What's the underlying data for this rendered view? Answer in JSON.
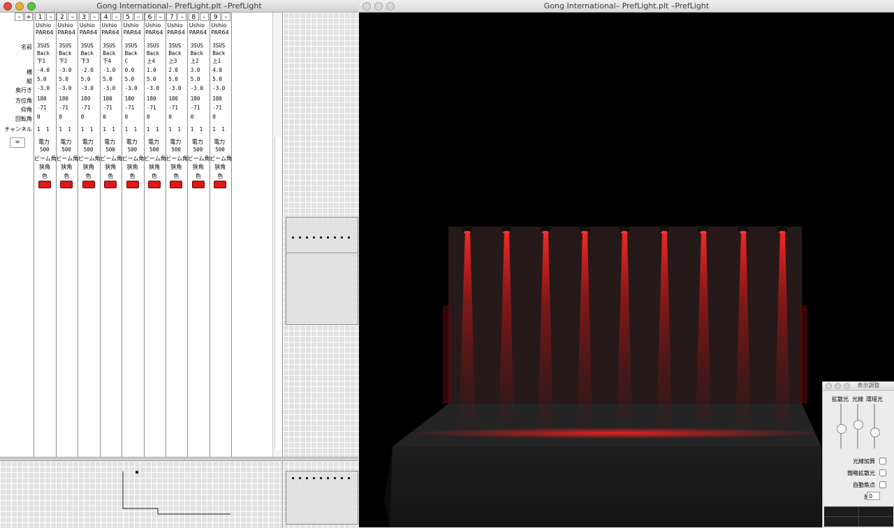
{
  "window_left": {
    "title": "Gong International– PrefLight.plt –PrefLight"
  },
  "window_right": {
    "title": "Gong International– PrefLight.plt –PrefLight"
  },
  "header": {
    "minus_label": "–",
    "plus_label": "+",
    "equals_label": "="
  },
  "row_labels": {
    "name": "名前",
    "x": "横",
    "y": "縦",
    "z": "奥行き",
    "azimuth": "方位角",
    "elevation": "仰角",
    "rotation": "回転角",
    "channel": "チャンネル"
  },
  "fixture_labels": {
    "power": "電力",
    "beam": "ビーム角",
    "color": "色"
  },
  "fixtures": [
    {
      "num": "1",
      "make": "Ushio",
      "model": "PAR64",
      "name1": "3SUS",
      "name2": "Back",
      "name3": "下1",
      "x": "-4.0",
      "y": "5.0",
      "z": "-3.0",
      "azimuth": "180",
      "elevation": "-71",
      "rotation": "0",
      "ch1": "1",
      "ch2": "1",
      "power": "500",
      "beam": "狭角"
    },
    {
      "num": "2",
      "make": "Ushio",
      "model": "PAR64",
      "name1": "3SUS",
      "name2": "Back",
      "name3": "下2",
      "x": "-3.0",
      "y": "5.0",
      "z": "-3.0",
      "azimuth": "180",
      "elevation": "-71",
      "rotation": "0",
      "ch1": "1",
      "ch2": "1",
      "power": "500",
      "beam": "狭角"
    },
    {
      "num": "3",
      "make": "Ushio",
      "model": "PAR64",
      "name1": "3SUS",
      "name2": "Back",
      "name3": "下3",
      "x": "-2.0",
      "y": "5.0",
      "z": "-3.0",
      "azimuth": "180",
      "elevation": "-71",
      "rotation": "0",
      "ch1": "1",
      "ch2": "1",
      "power": "500",
      "beam": "狭角"
    },
    {
      "num": "4",
      "make": "Ushio",
      "model": "PAR64",
      "name1": "3SUS",
      "name2": "Back",
      "name3": "下4",
      "x": "-1.0",
      "y": "5.0",
      "z": "-3.0",
      "azimuth": "180",
      "elevation": "-71",
      "rotation": "0",
      "ch1": "1",
      "ch2": "1",
      "power": "500",
      "beam": "狭角"
    },
    {
      "num": "5",
      "make": "Ushio",
      "model": "PAR64",
      "name1": "3SUS",
      "name2": "Back",
      "name3": "C",
      "x": "0.0",
      "y": "5.0",
      "z": "-3.0",
      "azimuth": "180",
      "elevation": "-71",
      "rotation": "0",
      "ch1": "1",
      "ch2": "1",
      "power": "500",
      "beam": "狭角"
    },
    {
      "num": "6",
      "make": "Ushio",
      "model": "PAR64",
      "name1": "3SUS",
      "name2": "Back",
      "name3": "上4",
      "x": "1.0",
      "y": "5.0",
      "z": "-3.0",
      "azimuth": "180",
      "elevation": "-71",
      "rotation": "0",
      "ch1": "1",
      "ch2": "1",
      "power": "500",
      "beam": "狭角"
    },
    {
      "num": "7",
      "make": "Ushio",
      "model": "PAR64",
      "name1": "3SUS",
      "name2": "Back",
      "name3": "上3",
      "x": "2.0",
      "y": "5.0",
      "z": "-3.0",
      "azimuth": "180",
      "elevation": "-71",
      "rotation": "0",
      "ch1": "1",
      "ch2": "1",
      "power": "500",
      "beam": "狭角"
    },
    {
      "num": "8",
      "make": "Ushio",
      "model": "PAR64",
      "name1": "3SUS",
      "name2": "Back",
      "name3": "上2",
      "x": "3.0",
      "y": "5.0",
      "z": "-3.0",
      "azimuth": "180",
      "elevation": "-71",
      "rotation": "0",
      "ch1": "1",
      "ch2": "1",
      "power": "500",
      "beam": "狭角"
    },
    {
      "num": "9",
      "make": "Ushio",
      "model": "PAR64",
      "name1": "3SUS",
      "name2": "Back",
      "name3": "上1",
      "x": "4.0",
      "y": "5.0",
      "z": "-3.0",
      "azimuth": "180",
      "elevation": "-71",
      "rotation": "0",
      "ch1": "1",
      "ch2": "1",
      "power": "500",
      "beam": "狭角"
    }
  ],
  "display_settings": {
    "title": "表示調整",
    "slider_diffuse": "拡散光",
    "slider_beam": "光線",
    "slider_ambient": "環境光",
    "diffuse_level": 0.45,
    "beam_level": 0.55,
    "ambient_level": 0.35,
    "beam_additive": "光線加算",
    "simple_diffuse": "簡略拡散光",
    "auto_focus": "自動焦点",
    "sensitivity_label": "感度",
    "sensitivity_value": "0"
  },
  "colors": {
    "light_red": "#e01818",
    "stage_gray": "#2a2a2a"
  }
}
